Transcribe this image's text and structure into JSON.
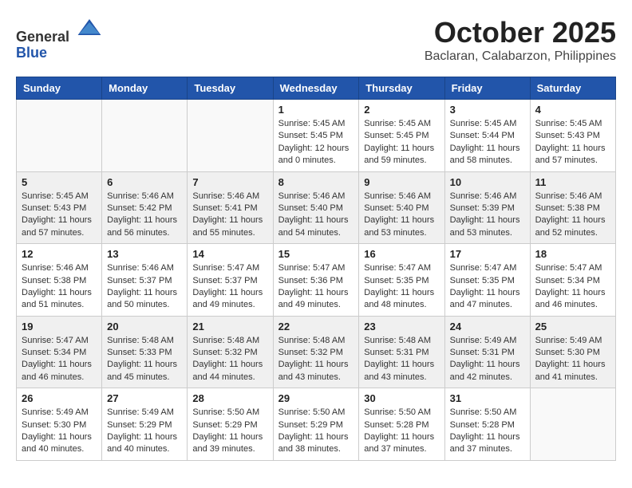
{
  "logo": {
    "general": "General",
    "blue": "Blue"
  },
  "title": "October 2025",
  "location": "Baclaran, Calabarzon, Philippines",
  "weekdays": [
    "Sunday",
    "Monday",
    "Tuesday",
    "Wednesday",
    "Thursday",
    "Friday",
    "Saturday"
  ],
  "weeks": [
    [
      {
        "day": "",
        "info": ""
      },
      {
        "day": "",
        "info": ""
      },
      {
        "day": "",
        "info": ""
      },
      {
        "day": "1",
        "info": "Sunrise: 5:45 AM\nSunset: 5:45 PM\nDaylight: 12 hours\nand 0 minutes."
      },
      {
        "day": "2",
        "info": "Sunrise: 5:45 AM\nSunset: 5:45 PM\nDaylight: 11 hours\nand 59 minutes."
      },
      {
        "day": "3",
        "info": "Sunrise: 5:45 AM\nSunset: 5:44 PM\nDaylight: 11 hours\nand 58 minutes."
      },
      {
        "day": "4",
        "info": "Sunrise: 5:45 AM\nSunset: 5:43 PM\nDaylight: 11 hours\nand 57 minutes."
      }
    ],
    [
      {
        "day": "5",
        "info": "Sunrise: 5:45 AM\nSunset: 5:43 PM\nDaylight: 11 hours\nand 57 minutes."
      },
      {
        "day": "6",
        "info": "Sunrise: 5:46 AM\nSunset: 5:42 PM\nDaylight: 11 hours\nand 56 minutes."
      },
      {
        "day": "7",
        "info": "Sunrise: 5:46 AM\nSunset: 5:41 PM\nDaylight: 11 hours\nand 55 minutes."
      },
      {
        "day": "8",
        "info": "Sunrise: 5:46 AM\nSunset: 5:40 PM\nDaylight: 11 hours\nand 54 minutes."
      },
      {
        "day": "9",
        "info": "Sunrise: 5:46 AM\nSunset: 5:40 PM\nDaylight: 11 hours\nand 53 minutes."
      },
      {
        "day": "10",
        "info": "Sunrise: 5:46 AM\nSunset: 5:39 PM\nDaylight: 11 hours\nand 53 minutes."
      },
      {
        "day": "11",
        "info": "Sunrise: 5:46 AM\nSunset: 5:38 PM\nDaylight: 11 hours\nand 52 minutes."
      }
    ],
    [
      {
        "day": "12",
        "info": "Sunrise: 5:46 AM\nSunset: 5:38 PM\nDaylight: 11 hours\nand 51 minutes."
      },
      {
        "day": "13",
        "info": "Sunrise: 5:46 AM\nSunset: 5:37 PM\nDaylight: 11 hours\nand 50 minutes."
      },
      {
        "day": "14",
        "info": "Sunrise: 5:47 AM\nSunset: 5:37 PM\nDaylight: 11 hours\nand 49 minutes."
      },
      {
        "day": "15",
        "info": "Sunrise: 5:47 AM\nSunset: 5:36 PM\nDaylight: 11 hours\nand 49 minutes."
      },
      {
        "day": "16",
        "info": "Sunrise: 5:47 AM\nSunset: 5:35 PM\nDaylight: 11 hours\nand 48 minutes."
      },
      {
        "day": "17",
        "info": "Sunrise: 5:47 AM\nSunset: 5:35 PM\nDaylight: 11 hours\nand 47 minutes."
      },
      {
        "day": "18",
        "info": "Sunrise: 5:47 AM\nSunset: 5:34 PM\nDaylight: 11 hours\nand 46 minutes."
      }
    ],
    [
      {
        "day": "19",
        "info": "Sunrise: 5:47 AM\nSunset: 5:34 PM\nDaylight: 11 hours\nand 46 minutes."
      },
      {
        "day": "20",
        "info": "Sunrise: 5:48 AM\nSunset: 5:33 PM\nDaylight: 11 hours\nand 45 minutes."
      },
      {
        "day": "21",
        "info": "Sunrise: 5:48 AM\nSunset: 5:32 PM\nDaylight: 11 hours\nand 44 minutes."
      },
      {
        "day": "22",
        "info": "Sunrise: 5:48 AM\nSunset: 5:32 PM\nDaylight: 11 hours\nand 43 minutes."
      },
      {
        "day": "23",
        "info": "Sunrise: 5:48 AM\nSunset: 5:31 PM\nDaylight: 11 hours\nand 43 minutes."
      },
      {
        "day": "24",
        "info": "Sunrise: 5:49 AM\nSunset: 5:31 PM\nDaylight: 11 hours\nand 42 minutes."
      },
      {
        "day": "25",
        "info": "Sunrise: 5:49 AM\nSunset: 5:30 PM\nDaylight: 11 hours\nand 41 minutes."
      }
    ],
    [
      {
        "day": "26",
        "info": "Sunrise: 5:49 AM\nSunset: 5:30 PM\nDaylight: 11 hours\nand 40 minutes."
      },
      {
        "day": "27",
        "info": "Sunrise: 5:49 AM\nSunset: 5:29 PM\nDaylight: 11 hours\nand 40 minutes."
      },
      {
        "day": "28",
        "info": "Sunrise: 5:50 AM\nSunset: 5:29 PM\nDaylight: 11 hours\nand 39 minutes."
      },
      {
        "day": "29",
        "info": "Sunrise: 5:50 AM\nSunset: 5:29 PM\nDaylight: 11 hours\nand 38 minutes."
      },
      {
        "day": "30",
        "info": "Sunrise: 5:50 AM\nSunset: 5:28 PM\nDaylight: 11 hours\nand 37 minutes."
      },
      {
        "day": "31",
        "info": "Sunrise: 5:50 AM\nSunset: 5:28 PM\nDaylight: 11 hours\nand 37 minutes."
      },
      {
        "day": "",
        "info": ""
      }
    ]
  ]
}
